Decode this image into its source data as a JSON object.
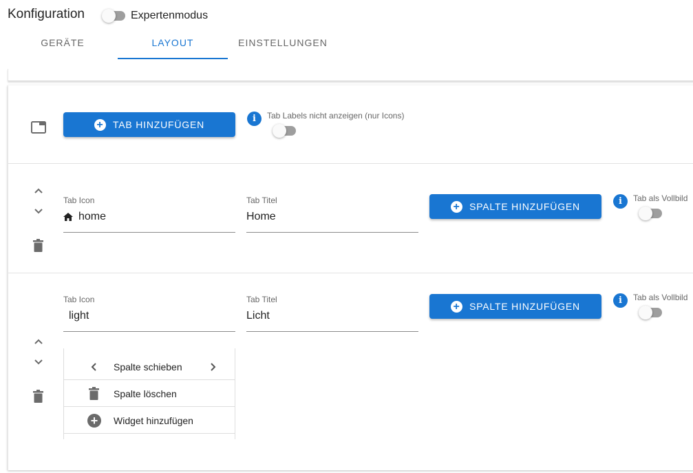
{
  "header": {
    "title": "Konfiguration",
    "expert_mode_label": "Expertenmodus",
    "expert_mode_on": false
  },
  "tabs": [
    {
      "label": "GERÄTE",
      "active": false
    },
    {
      "label": "LAYOUT",
      "active": true
    },
    {
      "label": "EINSTELLUNGEN",
      "active": false
    }
  ],
  "layout": {
    "add_tab_button": "TAB HINZUFÜGEN",
    "hide_tab_labels_label": "Tab Labels nicht anzeigen (nur Icons)",
    "hide_tab_labels_on": false,
    "tab_entries": [
      {
        "icon_label": "Tab Icon",
        "icon_value": "home",
        "title_label": "Tab Titel",
        "title_value": "Home",
        "add_column_button": "SPALTE HINZUFÜGEN",
        "fullscreen_label": "Tab als Vollbild",
        "fullscreen_on": false
      },
      {
        "icon_label": "Tab Icon",
        "icon_value": "light",
        "title_label": "Tab Titel",
        "title_value": "Licht",
        "add_column_button": "SPALTE HINZUFÜGEN",
        "fullscreen_label": "Tab als Vollbild",
        "fullscreen_on": false
      }
    ],
    "column_menu": {
      "move_column": "Spalte schieben",
      "delete_column": "Spalte löschen",
      "add_widget": "Widget hinzufügen"
    }
  },
  "icons": {
    "tab": "tab-icon",
    "info": "info-icon",
    "home": "home-icon",
    "move_up": "chevron-up-icon",
    "move_down": "chevron-down-icon",
    "delete": "trash-icon",
    "add": "plus-circle-icon"
  },
  "colors": {
    "accent": "#1976d2",
    "switch_off": "#9e9e9e",
    "icon_grey": "#6b6b6b"
  }
}
